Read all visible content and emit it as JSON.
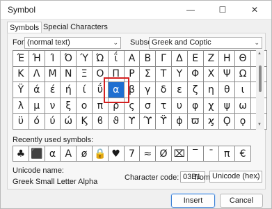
{
  "window": {
    "title": "Symbol",
    "minimize": "—",
    "maximize": "☐",
    "close": "✕"
  },
  "tabs": [
    {
      "label": "Symbols"
    },
    {
      "label": "Special Characters"
    }
  ],
  "font": {
    "label": "Font:",
    "value": "(normal text)"
  },
  "subset": {
    "label": "Subset:",
    "value": "Greek and Coptic"
  },
  "grid": [
    [
      "Έ",
      "Ή",
      "Ί",
      "Ό",
      "Ύ",
      "Ώ",
      "ΐ",
      "Α",
      "Β",
      "Γ",
      "Δ",
      "Ε",
      "Ζ",
      "Η",
      "Θ",
      "Ι"
    ],
    [
      "Κ",
      "Λ",
      "Μ",
      "Ν",
      "Ξ",
      "Ο",
      "Π",
      "Ρ",
      "Σ",
      "Τ",
      "Υ",
      "Φ",
      "Χ",
      "Ψ",
      "Ω",
      "Ϊ"
    ],
    [
      "Ϋ",
      "ά",
      "έ",
      "ή",
      "ί",
      "ΰ",
      "α",
      "β",
      "γ",
      "δ",
      "ε",
      "ζ",
      "η",
      "θ",
      "ι",
      "κ"
    ],
    [
      "λ",
      "μ",
      "ν",
      "ξ",
      "ο",
      "π",
      "ρ",
      "ς",
      "σ",
      "τ",
      "υ",
      "φ",
      "χ",
      "ψ",
      "ω",
      "ϊ"
    ],
    [
      "ϋ",
      "ό",
      "ύ",
      "ώ",
      "Ϗ",
      "ϐ",
      "ϑ",
      "ϒ",
      "ϓ",
      "ϔ",
      "ϕ",
      "ϖ",
      "ϗ",
      "Ϙ",
      "ϙ",
      "Ϛ"
    ]
  ],
  "selected_symbol": "α",
  "recent": {
    "label": "Recently used symbols:",
    "items": [
      "♣",
      "⬛",
      "α",
      "Α",
      "ø",
      "🔒",
      "♥",
      "7",
      "≈",
      "Ø",
      "⌧",
      "‾",
      "¯",
      "π",
      "€"
    ]
  },
  "unicode": {
    "name_label": "Unicode name:",
    "name_value": "Greek Small Letter Alpha"
  },
  "character_code": {
    "label": "Character code:",
    "value": "03B1"
  },
  "from": {
    "label": "from:",
    "value": "Unicode (hex)"
  },
  "buttons": {
    "insert": "Insert",
    "cancel": "Cancel"
  }
}
